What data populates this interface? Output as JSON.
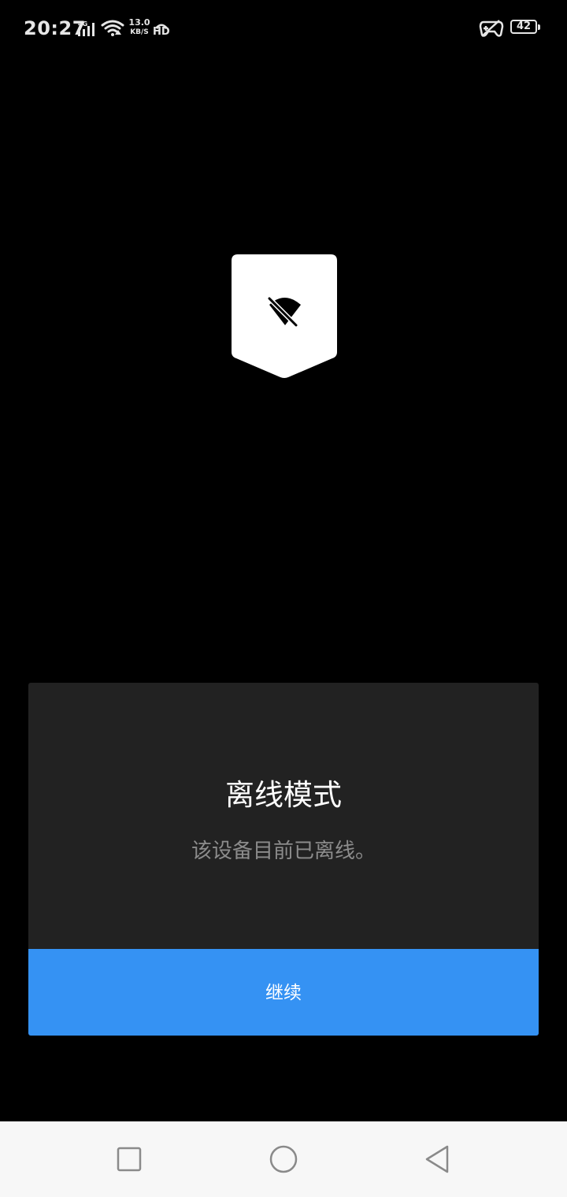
{
  "status_bar": {
    "time": "20:27",
    "network_type": "4G",
    "net_speed_value": "13.0",
    "net_speed_unit": "KB/S",
    "hd_label": "HD",
    "battery_level": "42",
    "icons": [
      "signal-icon",
      "wifi-icon",
      "hd-call-icon",
      "game-mode-icon",
      "battery-icon"
    ]
  },
  "badge": {
    "icon": "wifi-off-icon",
    "color": "#ffffff"
  },
  "dialog": {
    "title": "离线模式",
    "message": "该设备目前已离线。",
    "continue_label": "继续",
    "background": "#222222",
    "button_color": "#3592f3"
  },
  "nav_bar": {
    "icons": [
      "recent-apps-icon",
      "home-icon",
      "back-icon"
    ]
  }
}
